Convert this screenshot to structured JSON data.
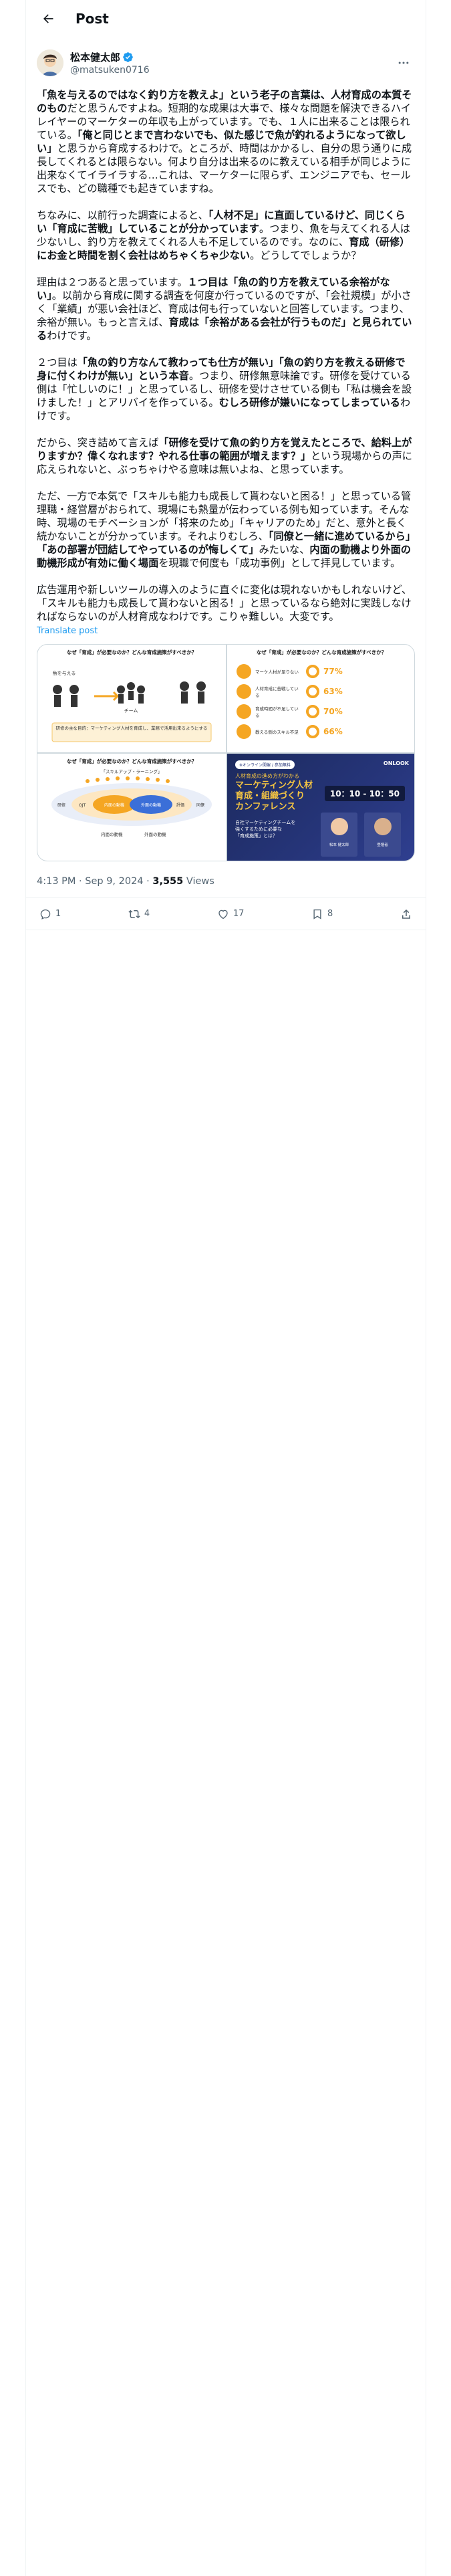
{
  "header": {
    "title": "Post"
  },
  "author": {
    "name": "松本健太郎",
    "handle": "@matsuken0716"
  },
  "post": {
    "paragraphs": [
      "<b>「魚を与えるのではなく釣り方を教えよ」という老子の言葉は、人材育成の本質そのもの</b>だと思うんですよね。短期的な成果は大事で、様々な問題を解決できるハイレイヤーのマーケターの年収も上がっています。でも、１人に出来ることは限られている。<b>「俺と同じとまで言わないでも、似た感じで魚が釣れるようになって欲しい」</b>と思うから育成するわけで。ところが、時間はかかるし、自分の思う通りに成長してくれるとは限らない。何より自分は出来るのに教えている相手が同じように出来なくてイライラする…これは、マーケターに限らず、エンジニアでも、セールスでも、どの職種でも起きていますね。",
      "ちなみに、以前行った調査によると、<b>「人材不足」に直面しているけど、同じくらい「育成に苦戦」していることが分かっています</b>。つまり、魚を与えてくれる人は少ないし、釣り方を教えてくれる人も不足しているのです。なのに、<b>育成（研修）にお金と時間を割く会社はめちゃくちゃ少ない</b>。どうしてでしょうか？",
      "理由は２つあると思っています。<b>１つ目は「魚の釣り方を教えている余裕がない」</b>。以前から育成に関する調査を何度か行っているのですが、「会社規模」が小さく「業績」が悪い会社ほど、育成は何も行っていないと回答しています。つまり、余裕が無い。もっと言えば、<b>育成は「余裕がある会社が行うものだ」と見られている</b>わけです。",
      "２つ目は<b>「魚の釣り方なんて教わっても仕方が無い」「魚の釣り方を教える研修で身に付くわけが無い」という本音</b>。つまり、研修無意味論です。研修を受けている側は「忙しいのに！」と思っているし、研修を受けさせている側も「私は機会を設けました！」とアリバイを作っている。<b>むしろ研修が嫌いになってしまっている</b>わけです。",
      "だから、突き詰めて言えば<b>「研修を受けて魚の釣り方を覚えたところで、給料上がりますか？偉くなれます？やれる仕事の範囲が増えます？」</b>という現場からの声に応えられないと、ぶっちゃけやる意味は無いよね、と思っています。",
      "ただ、一方で本気で「スキルも能力も成長して貰わないと困る！」と思っている管理職・経営層がおられて、現場にも熱量が伝わっている例も知っています。そんな時、現場のモチベーションが「将来のため」「キャリアのため」だと、意外と長く続かないことが分かっています。それよりむしろ、<b>「同僚と一緒に進めているから」「あの部署が団結してやっているのが悔しくて」</b>みたいな、<b>内面の動機より外面の動機形成が有効に働く場面</b>を現職で何度も「成功事例」として拝見しています。",
      "広告運用や新しいツールの導入のように直ぐに変化は現れないかもしれないけど、「スキルも能力も成長して貰わないと困る！」と思っているなら絶対に実践しなければならないのが人材育成なわけです。こりゃ難しい。大変です。"
    ],
    "translate": "Translate post",
    "time": "4:13 PM · Sep 9, 2024 · ",
    "views_count": "3,555",
    "views_label": " Views"
  },
  "media": {
    "img1": {
      "title": "なぜ「育成」が必要なのか？どんな育成施策がすべきか？",
      "bubble": "魚を与える",
      "person": "チーム",
      "box": "研修の主な目的：マーケティング人材を育成し、業務で活用出来るようにする"
    },
    "img2": {
      "title": "なぜ「育成」が必要なのか？どんな育成施策がすべきか？",
      "rows": [
        {
          "label": "マーケ人材が足りない",
          "pct": "77%",
          "value": 77
        },
        {
          "label": "人材育成に苦戦している",
          "pct": "63%",
          "value": 63
        },
        {
          "label": "育成時間が不足している",
          "pct": "70%",
          "value": 70
        },
        {
          "label": "教える側のスキル不足",
          "pct": "66%",
          "value": 66
        }
      ]
    },
    "img3": {
      "title": "なぜ「育成」が必要なのか？どんな育成施策がすべきか？",
      "label_top": "「スキルアップ・ラーニング」",
      "labels": [
        "研修",
        "OJT",
        "内面の動機",
        "外面の動機",
        "評価",
        "同僚"
      ],
      "footer_left": "内面の動機",
      "footer_right": "外面の動機"
    },
    "img4": {
      "pill": "※オンライン開催 / 参加無料",
      "tagline": "人材育成の進め方がわかる",
      "line1": "マーケティング人材",
      "line2": "育成・組織づくり",
      "line3": "カンファレンス",
      "time": "10：10 - 10：50",
      "desc1": "自社マーケティングチームを",
      "desc2": "強くするために必要な",
      "desc3": "「育成施策」とは？",
      "brand": "ONLOOK",
      "speaker1": "松本 健太郎",
      "speaker2": "登壇者"
    }
  },
  "actions": {
    "replies": "1",
    "reposts": "4",
    "likes": "17",
    "bookmarks": "8"
  },
  "colors": {
    "accent": "#1d9bf0",
    "text": "#0f1419",
    "muted": "#536471"
  }
}
